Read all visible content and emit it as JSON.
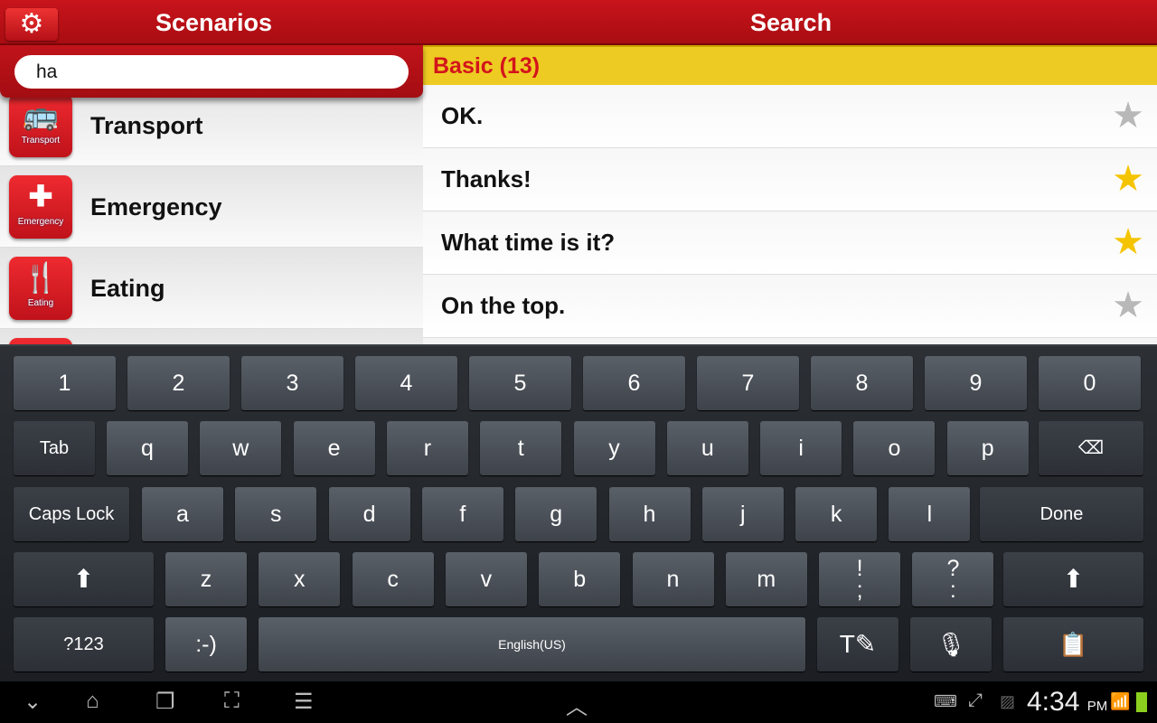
{
  "header": {
    "left_title": "Scenarios",
    "right_title": "Search"
  },
  "search": {
    "value": "ha"
  },
  "categories": [
    {
      "label": "Transport",
      "icon_caption": "Transport",
      "icon": "bus-icon",
      "glyph": "🚌"
    },
    {
      "label": "Emergency",
      "icon_caption": "Emergency",
      "icon": "first-aid-icon",
      "glyph": "✚"
    },
    {
      "label": "Eating",
      "icon_caption": "Eating",
      "icon": "fork-plate-icon",
      "glyph": "🍴"
    }
  ],
  "results": {
    "section": "Basic (13)",
    "phrases": [
      {
        "text": "OK.",
        "starred": false
      },
      {
        "text": "Thanks!",
        "starred": true
      },
      {
        "text": "What time is it?",
        "starred": true
      },
      {
        "text": "On the top.",
        "starred": false
      }
    ]
  },
  "keyboard": {
    "row1": [
      "1",
      "2",
      "3",
      "4",
      "5",
      "6",
      "7",
      "8",
      "9",
      "0"
    ],
    "row2": [
      "q",
      "w",
      "e",
      "r",
      "t",
      "y",
      "u",
      "i",
      "o",
      "p"
    ],
    "row3": [
      "a",
      "s",
      "d",
      "f",
      "g",
      "h",
      "j",
      "k",
      "l"
    ],
    "row4": [
      "z",
      "x",
      "c",
      "v",
      "b",
      "n",
      "m",
      "!\n;",
      "?\n:"
    ],
    "tab": "Tab",
    "caps": "Caps Lock",
    "done": "Done",
    "sym": "?123",
    "smiley": ":-)",
    "space": "English(US)"
  },
  "statusbar": {
    "time": "4:34",
    "ampm": "PM"
  },
  "colors": {
    "header_red": "#c8141b",
    "section_yellow": "#eecb22",
    "star_gold": "#f5c400",
    "star_gray": "#b8b8b8"
  }
}
